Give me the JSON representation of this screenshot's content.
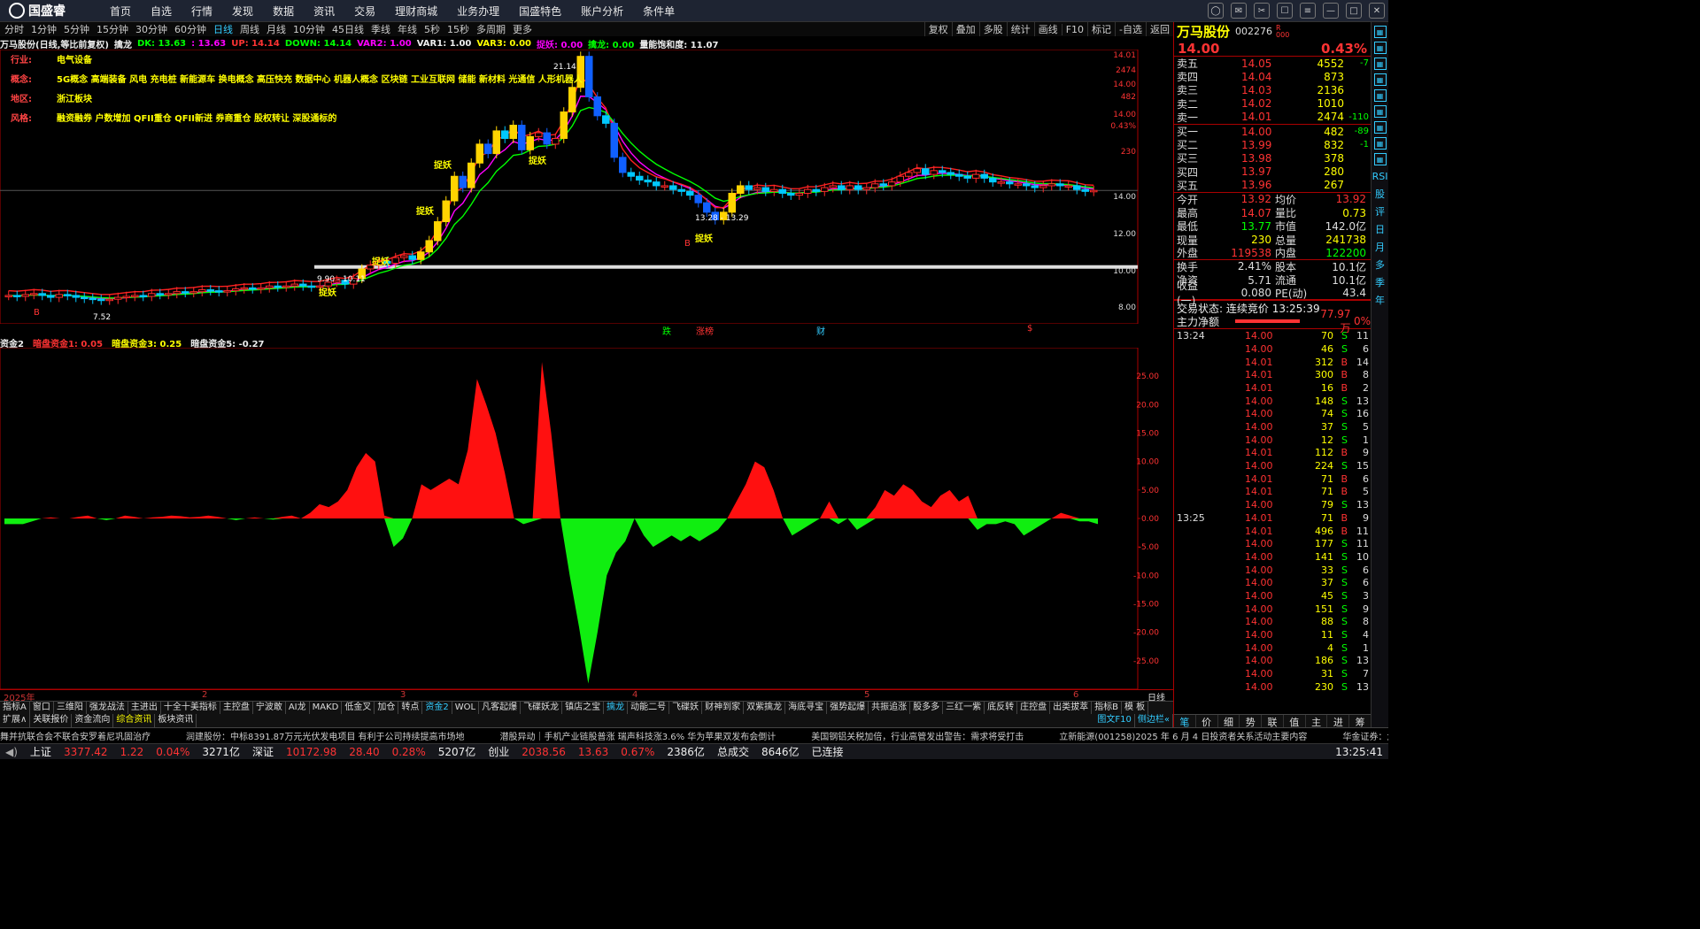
{
  "app": {
    "name": "国盛睿"
  },
  "menu": [
    "首页",
    "自选",
    "行情",
    "发现",
    "数据",
    "资讯",
    "交易",
    "理财商城",
    "业务办理",
    "国盛特色",
    "账户分析",
    "条件单"
  ],
  "periods": [
    "分时",
    "1分钟",
    "5分钟",
    "15分钟",
    "30分钟",
    "60分钟",
    "日线",
    "周线",
    "月线",
    "10分钟",
    "45日线",
    "季线",
    "年线",
    "5秒",
    "15秒",
    "多周期",
    "更多"
  ],
  "active_period": "日线",
  "toolbar": [
    "复权",
    "叠加",
    "多股",
    "统计",
    "画线",
    "F10",
    "标记",
    "-自选",
    "返回"
  ],
  "indicator_line": {
    "title": "万马股份(日线,等比前复权)",
    "name": "擒龙",
    "dk": "DK: 13.63",
    "dk2": ": 13.63",
    "up": "UP: 14.14",
    "down": "DOWN: 14.14",
    "var2": "VAR2: 1.00",
    "var1": "VAR1: 1.00",
    "var3": "VAR3: 0.00",
    "zy": "捉妖: 0.00",
    "ql": "擒龙: 0.00",
    "zn": "量能饱和度: 11.07"
  },
  "concepts": [
    {
      "label": "行业:",
      "value": "电气设备"
    },
    {
      "label": "概念:",
      "value": "5G概念 高端装备 风电 充电桩 新能源车 换电概念 高压快充 数据中心 机器人概念 区块链 工业互联网 储能 新材料 光通信 人形机器人"
    },
    {
      "label": "地区:",
      "value": "浙江板块"
    },
    {
      "label": "风格:",
      "value": "融资融券 户数增加 QFII重仓 QFII新进 券商重仓 股权转让 深股通标的"
    }
  ],
  "chart_data": [
    {
      "type": "candlestick",
      "title": "万马股份(日线,等比前复权)",
      "ylim": [
        7.0,
        21.5
      ],
      "ylabels": [
        "14.01",
        "2474",
        "14.00",
        "482",
        "14.00",
        "0.43%",
        "230",
        "14.00",
        "12.00",
        "10.00",
        "8.00"
      ],
      "annotations": [
        "21.14",
        "13.28 - 13.29",
        "9.90 - 10.11",
        "7.52",
        "捉妖",
        "B"
      ],
      "x_month_labels": [
        "2025年",
        "2",
        "3",
        "4",
        "5",
        "6"
      ],
      "candles_close": [
        8.5,
        8.45,
        8.55,
        8.6,
        8.5,
        8.4,
        8.55,
        8.5,
        8.4,
        8.35,
        8.3,
        8.25,
        8.3,
        8.4,
        8.45,
        8.5,
        8.45,
        8.6,
        8.55,
        8.6,
        8.7,
        8.65,
        8.7,
        8.8,
        8.75,
        8.7,
        8.75,
        8.85,
        8.9,
        8.85,
        8.9,
        9.0,
        8.95,
        9.0,
        9.1,
        9.0,
        8.95,
        9.0,
        9.2,
        9.3,
        9.1,
        9.4,
        9.9,
        10.1,
        10.3,
        10.2,
        10.5,
        10.6,
        10.4,
        10.8,
        11.4,
        12.4,
        13.5,
        14.8,
        14.2,
        15.5,
        16.5,
        16.0,
        17.2,
        16.8,
        17.5,
        16.2,
        16.9,
        17.1,
        16.5,
        16.8,
        18.2,
        19.5,
        21.14,
        19.0,
        18.0,
        17.6,
        15.8,
        15.0,
        14.8,
        14.6,
        14.5,
        14.3,
        14.3,
        14.1,
        14.0,
        13.8,
        13.4,
        12.9,
        12.5,
        12.9,
        13.9,
        14.3,
        14.1,
        14.2,
        14.0,
        14.1,
        13.9,
        13.8,
        13.9,
        14.1,
        14.0,
        14.2,
        14.3,
        14.1,
        14.3,
        14.1,
        14.2,
        14.4,
        14.3,
        14.5,
        14.8,
        15.0,
        15.2,
        14.9,
        15.1,
        15.0,
        14.9,
        14.8,
        14.7,
        14.9,
        14.7,
        14.5,
        14.5,
        14.4,
        14.4,
        14.3,
        14.2,
        14.3,
        14.4,
        14.3,
        14.3,
        14.1,
        14.0,
        14.05
      ],
      "series": [
        {
          "name": "DK",
          "color": "#ff00ff"
        },
        {
          "name": "UP",
          "color": "#ff2020"
        },
        {
          "name": "DOWN",
          "color": "#00ff00"
        }
      ]
    },
    {
      "type": "area",
      "title": "资金2",
      "ylim": [
        -30,
        30
      ],
      "yticks": [
        "25.00",
        "20.00",
        "15.00",
        "10.00",
        "5.00",
        "0.00",
        "-5.00",
        "-10.00",
        "-15.00",
        "-20.00",
        "-25.00"
      ],
      "values": [
        -1,
        -1,
        -1,
        -0.5,
        0,
        0.2,
        0,
        0,
        0.3,
        0.5,
        0,
        -0.3,
        0,
        0.5,
        0.3,
        0,
        0.2,
        0.3,
        0.5,
        0.4,
        0.2,
        0.3,
        0.5,
        0.3,
        0,
        -0.3,
        0,
        0.2,
        0,
        -0.2,
        0.3,
        0.5,
        0,
        1,
        2.5,
        2,
        3,
        5,
        9,
        11.5,
        10,
        0.5,
        -5,
        -3.5,
        0,
        6,
        5,
        6,
        7,
        6,
        12,
        24.5,
        20,
        15,
        8,
        0,
        -1,
        -0.5,
        27.5,
        15,
        0,
        -10,
        -19,
        -29,
        -20,
        -10,
        -6,
        -4,
        0,
        -3,
        -5,
        -4,
        -3,
        -4,
        -3,
        -4,
        -3,
        -2,
        0,
        3,
        6,
        10,
        9,
        5,
        0,
        -3,
        -2,
        -1,
        0,
        3,
        -1,
        0,
        -2,
        -1,
        2,
        5,
        4,
        6,
        5,
        3,
        2,
        4,
        5,
        3,
        4,
        -2,
        -1,
        -1,
        -0.5,
        -1,
        -3,
        -2,
        -1,
        0,
        1,
        0.5,
        -0.5,
        -0.5,
        -1
      ],
      "series": [
        {
          "name": "暗盘资金1",
          "label": "暗盘资金1: 0.05",
          "color": "#ff2020"
        },
        {
          "name": "暗盘资金3",
          "label": "暗盘资金3: 0.25",
          "color": "#ff0"
        },
        {
          "name": "暗盘资金5",
          "label": "暗盘资金5: -0.27",
          "color": "#fff"
        }
      ]
    }
  ],
  "markers": [
    "跌",
    "涨榜",
    "财",
    "$"
  ],
  "subchart": {
    "label": "资金2"
  },
  "bottom_axis_label": "日线",
  "tabs_row1": [
    "指标A",
    "窗口",
    "三维阳",
    "强龙战法",
    "主进出",
    "十全十美指标",
    "主控盘",
    "宁波敢",
    "AI龙",
    "MAKD",
    "低金叉",
    "加仓",
    "转点",
    "资金2",
    "WOL",
    "凡客起爆",
    "飞碟妖龙",
    "镇店之宝",
    "擒龙",
    "动能二号",
    "飞碟妖",
    "财神到家",
    "双紫擒龙",
    "海底寻宝",
    "强势起爆",
    "共振追涨",
    "股多多",
    "三红一紫",
    "底反转",
    "庄控盘",
    "出类拔萃",
    "指标B",
    "模 板"
  ],
  "tabs_row1_selected": [
    "资金2",
    "擒龙"
  ],
  "tabs_row2": [
    "扩展∧",
    "关联报价",
    "资金流向",
    "综合资讯",
    "板块资讯"
  ],
  "tabs_row2_selected": "综合资讯",
  "right_tabs": [
    "图文F10",
    "侧边栏«"
  ],
  "news": [
    "舞并抗联合会不联合安罗着尼巩固治疗",
    "润建股份：中标8391.87万元光伏发电项目 有利于公司持续提高市场地",
    "潜股异动｜手机产业链股普涨 瑞声科技涨3.6% 华为苹果双发布会倒计",
    "美国钢铝关税加倍，行业高管发出警告：需求将受打击",
    "立新能源(001258)2025 年 6 月 4 日投资者关系活动主要内容",
    "华金证券：六维力传感器"
  ],
  "status": {
    "sh_label": "上证",
    "sh_price": "3377.42",
    "sh_chg": "1.22",
    "sh_pct": "0.04%",
    "sh_amt": "3271亿",
    "sz_label": "深证",
    "sz_price": "10172.98",
    "sz_chg": "28.40",
    "sz_pct": "0.28%",
    "sz_amt": "5207亿",
    "cy_label": "创业",
    "cy_price": "2038.56",
    "cy_chg": "13.63",
    "cy_pct": "0.67%",
    "cy_amt": "2386亿",
    "total_label": "总成交",
    "total_amt": "8646亿",
    "conn": "已连接",
    "time": "13:25:41"
  },
  "quote": {
    "name": "万马股份",
    "code": "002276",
    "rtag1": "R",
    "rtag2": "000",
    "price": "14.00",
    "pct": "0.43%",
    "asks": [
      [
        "卖五",
        "14.05",
        "4552",
        "-7"
      ],
      [
        "卖四",
        "14.04",
        "873",
        ""
      ],
      [
        "卖三",
        "14.03",
        "2136",
        ""
      ],
      [
        "卖二",
        "14.02",
        "1010",
        ""
      ],
      [
        "卖一",
        "14.01",
        "2474",
        "-110"
      ]
    ],
    "bids": [
      [
        "买一",
        "14.00",
        "482",
        "-89"
      ],
      [
        "买二",
        "13.99",
        "832",
        "-1"
      ],
      [
        "买三",
        "13.98",
        "378",
        ""
      ],
      [
        "买四",
        "13.97",
        "280",
        ""
      ],
      [
        "买五",
        "13.96",
        "267",
        ""
      ]
    ],
    "info": [
      [
        "今开",
        "13.92",
        "均价",
        "13.92"
      ],
      [
        "最高",
        "14.07",
        "量比",
        "0.73"
      ],
      [
        "最低",
        "13.77",
        "市值",
        "142.0亿"
      ],
      [
        "现量",
        "230",
        "总量",
        "241738"
      ],
      [
        "外盘",
        "119538",
        "内盘",
        "122200"
      ],
      [
        "换手",
        "2.41%",
        "股本",
        "10.1亿"
      ],
      [
        "净资",
        "5.71",
        "流通",
        "10.1亿"
      ],
      [
        "收益(一)",
        "0.080",
        "PE(动)",
        "43.4"
      ]
    ],
    "trade_status": "交易状态: 连续竞价",
    "trade_time": "13:25:39",
    "net_label": "主力净额",
    "net_value": "77.97万",
    "net_pct": "0%"
  },
  "trades": [
    [
      "13:24",
      "14.00",
      "70",
      "S",
      "11"
    ],
    [
      "",
      "14.00",
      "46",
      "S",
      "6"
    ],
    [
      "",
      "14.01",
      "312",
      "B",
      "14"
    ],
    [
      "",
      "14.01",
      "300",
      "B",
      "8"
    ],
    [
      "",
      "14.01",
      "16",
      "B",
      "2"
    ],
    [
      "",
      "14.00",
      "148",
      "S",
      "13"
    ],
    [
      "",
      "14.00",
      "74",
      "S",
      "16"
    ],
    [
      "",
      "14.00",
      "37",
      "S",
      "5"
    ],
    [
      "",
      "14.00",
      "12",
      "S",
      "1"
    ],
    [
      "",
      "14.01",
      "112",
      "B",
      "9"
    ],
    [
      "",
      "14.00",
      "224",
      "S",
      "15"
    ],
    [
      "",
      "14.01",
      "71",
      "B",
      "6"
    ],
    [
      "",
      "14.01",
      "71",
      "B",
      "5"
    ],
    [
      "",
      "14.00",
      "79",
      "S",
      "13"
    ],
    [
      "13:25",
      "14.01",
      "71",
      "B",
      "9"
    ],
    [
      "",
      "14.01",
      "496",
      "B",
      "11"
    ],
    [
      "",
      "14.00",
      "177",
      "S",
      "11"
    ],
    [
      "",
      "14.00",
      "141",
      "S",
      "10"
    ],
    [
      "",
      "14.00",
      "33",
      "S",
      "6"
    ],
    [
      "",
      "14.00",
      "37",
      "S",
      "6"
    ],
    [
      "",
      "14.00",
      "45",
      "S",
      "3"
    ],
    [
      "",
      "14.00",
      "151",
      "S",
      "9"
    ],
    [
      "",
      "14.00",
      "88",
      "S",
      "8"
    ],
    [
      "",
      "14.00",
      "11",
      "S",
      "4"
    ],
    [
      "",
      "14.00",
      "4",
      "S",
      "1"
    ],
    [
      "",
      "14.00",
      "186",
      "S",
      "13"
    ],
    [
      "",
      "14.00",
      "31",
      "S",
      "7"
    ],
    [
      "",
      "14.00",
      "230",
      "S",
      "13"
    ]
  ],
  "right_bottom": [
    "笔",
    "价",
    "细",
    "势",
    "联",
    "值",
    "主",
    "进",
    "筹"
  ],
  "sidebar": [
    "RSI",
    "股",
    "评",
    "日",
    "月",
    "多",
    "季",
    "年"
  ]
}
